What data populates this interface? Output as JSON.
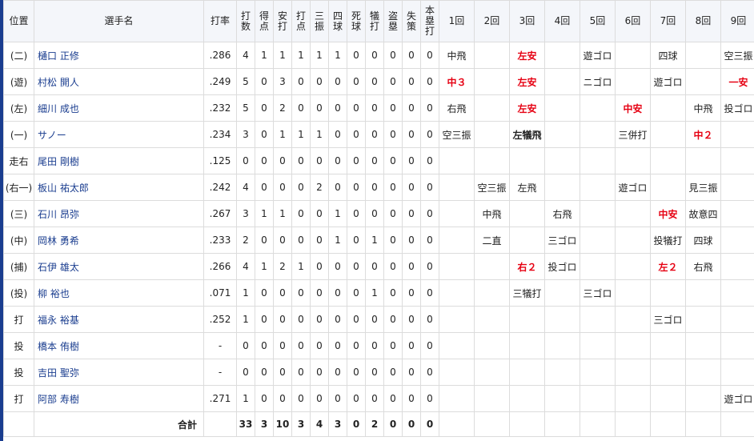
{
  "headers": {
    "pos": "位置",
    "name": "選手名",
    "stats": [
      "打率",
      "打数",
      "得点",
      "安打",
      "打点",
      "三振",
      "四球",
      "死球",
      "犠打",
      "盗塁",
      "失策",
      "本塁打"
    ],
    "innings": [
      "1回",
      "2回",
      "3回",
      "4回",
      "5回",
      "6回",
      "7回",
      "8回",
      "9回"
    ]
  },
  "players": [
    {
      "pos": "(二)",
      "name": "樋口 正修",
      "avg": ".286",
      "stats": [
        "4",
        "1",
        "1",
        "1",
        "1",
        "1",
        "0",
        "0",
        "0",
        "0",
        "0"
      ],
      "innings": [
        {
          "t": "中飛",
          "c": ""
        },
        {
          "t": "",
          "c": ""
        },
        {
          "t": "左安",
          "c": "red"
        },
        {
          "t": "",
          "c": ""
        },
        {
          "t": "遊ゴロ",
          "c": ""
        },
        {
          "t": "",
          "c": ""
        },
        {
          "t": "四球",
          "c": ""
        },
        {
          "t": "",
          "c": ""
        },
        {
          "t": "空三振",
          "c": ""
        }
      ]
    },
    {
      "pos": "(遊)",
      "name": "村松 開人",
      "avg": ".249",
      "stats": [
        "5",
        "0",
        "3",
        "0",
        "0",
        "0",
        "0",
        "0",
        "0",
        "0",
        "0"
      ],
      "innings": [
        {
          "t": "中３",
          "c": "red"
        },
        {
          "t": "",
          "c": ""
        },
        {
          "t": "左安",
          "c": "red"
        },
        {
          "t": "",
          "c": ""
        },
        {
          "t": "ニゴロ",
          "c": ""
        },
        {
          "t": "",
          "c": ""
        },
        {
          "t": "遊ゴロ",
          "c": ""
        },
        {
          "t": "",
          "c": ""
        },
        {
          "t": "一安",
          "c": "red"
        }
      ]
    },
    {
      "pos": "(左)",
      "name": "細川 成也",
      "avg": ".232",
      "stats": [
        "5",
        "0",
        "2",
        "0",
        "0",
        "0",
        "0",
        "0",
        "0",
        "0",
        "0"
      ],
      "innings": [
        {
          "t": "右飛",
          "c": ""
        },
        {
          "t": "",
          "c": ""
        },
        {
          "t": "左安",
          "c": "red"
        },
        {
          "t": "",
          "c": ""
        },
        {
          "t": "",
          "c": ""
        },
        {
          "t": "中安",
          "c": "red"
        },
        {
          "t": "",
          "c": ""
        },
        {
          "t": "中飛",
          "c": ""
        },
        {
          "t": "投ゴロ",
          "c": ""
        }
      ]
    },
    {
      "pos": "(一)",
      "name": "サノー",
      "avg": ".234",
      "stats": [
        "3",
        "0",
        "1",
        "1",
        "1",
        "0",
        "0",
        "0",
        "0",
        "0",
        "0"
      ],
      "innings": [
        {
          "t": "空三振",
          "c": ""
        },
        {
          "t": "",
          "c": ""
        },
        {
          "t": "左犠飛",
          "c": "bold"
        },
        {
          "t": "",
          "c": ""
        },
        {
          "t": "",
          "c": ""
        },
        {
          "t": "三併打",
          "c": ""
        },
        {
          "t": "",
          "c": ""
        },
        {
          "t": "中２",
          "c": "red"
        },
        {
          "t": "",
          "c": ""
        }
      ]
    },
    {
      "pos": "走右",
      "name": "尾田 剛樹",
      "avg": ".125",
      "stats": [
        "0",
        "0",
        "0",
        "0",
        "0",
        "0",
        "0",
        "0",
        "0",
        "0",
        "0"
      ],
      "innings": [
        {
          "t": "",
          "c": ""
        },
        {
          "t": "",
          "c": ""
        },
        {
          "t": "",
          "c": ""
        },
        {
          "t": "",
          "c": ""
        },
        {
          "t": "",
          "c": ""
        },
        {
          "t": "",
          "c": ""
        },
        {
          "t": "",
          "c": ""
        },
        {
          "t": "",
          "c": ""
        },
        {
          "t": "",
          "c": ""
        }
      ]
    },
    {
      "pos": "(右一)",
      "name": "板山 祐太郎",
      "avg": ".242",
      "stats": [
        "4",
        "0",
        "0",
        "0",
        "2",
        "0",
        "0",
        "0",
        "0",
        "0",
        "0"
      ],
      "innings": [
        {
          "t": "",
          "c": ""
        },
        {
          "t": "空三振",
          "c": ""
        },
        {
          "t": "左飛",
          "c": ""
        },
        {
          "t": "",
          "c": ""
        },
        {
          "t": "",
          "c": ""
        },
        {
          "t": "遊ゴロ",
          "c": ""
        },
        {
          "t": "",
          "c": ""
        },
        {
          "t": "見三振",
          "c": ""
        },
        {
          "t": "",
          "c": ""
        }
      ]
    },
    {
      "pos": "(三)",
      "name": "石川 昂弥",
      "avg": ".267",
      "stats": [
        "3",
        "1",
        "1",
        "0",
        "0",
        "1",
        "0",
        "0",
        "0",
        "0",
        "0"
      ],
      "innings": [
        {
          "t": "",
          "c": ""
        },
        {
          "t": "中飛",
          "c": ""
        },
        {
          "t": "",
          "c": ""
        },
        {
          "t": "右飛",
          "c": ""
        },
        {
          "t": "",
          "c": ""
        },
        {
          "t": "",
          "c": ""
        },
        {
          "t": "中安",
          "c": "red"
        },
        {
          "t": "故意四",
          "c": ""
        },
        {
          "t": "",
          "c": ""
        }
      ]
    },
    {
      "pos": "(中)",
      "name": "岡林 勇希",
      "avg": ".233",
      "stats": [
        "2",
        "0",
        "0",
        "0",
        "0",
        "1",
        "0",
        "1",
        "0",
        "0",
        "0"
      ],
      "innings": [
        {
          "t": "",
          "c": ""
        },
        {
          "t": "二直",
          "c": ""
        },
        {
          "t": "",
          "c": ""
        },
        {
          "t": "三ゴロ",
          "c": ""
        },
        {
          "t": "",
          "c": ""
        },
        {
          "t": "",
          "c": ""
        },
        {
          "t": "投犠打",
          "c": ""
        },
        {
          "t": "四球",
          "c": ""
        },
        {
          "t": "",
          "c": ""
        }
      ]
    },
    {
      "pos": "(捕)",
      "name": "石伊 雄太",
      "avg": ".266",
      "stats": [
        "4",
        "1",
        "2",
        "1",
        "0",
        "0",
        "0",
        "0",
        "0",
        "0",
        "0"
      ],
      "innings": [
        {
          "t": "",
          "c": ""
        },
        {
          "t": "",
          "c": ""
        },
        {
          "t": "右２",
          "c": "red"
        },
        {
          "t": "投ゴロ",
          "c": ""
        },
        {
          "t": "",
          "c": ""
        },
        {
          "t": "",
          "c": ""
        },
        {
          "t": "左２",
          "c": "red"
        },
        {
          "t": "右飛",
          "c": ""
        },
        {
          "t": "",
          "c": ""
        }
      ]
    },
    {
      "pos": "(投)",
      "name": "柳 裕也",
      "avg": ".071",
      "stats": [
        "1",
        "0",
        "0",
        "0",
        "0",
        "0",
        "0",
        "1",
        "0",
        "0",
        "0"
      ],
      "innings": [
        {
          "t": "",
          "c": ""
        },
        {
          "t": "",
          "c": ""
        },
        {
          "t": "三犠打",
          "c": ""
        },
        {
          "t": "",
          "c": ""
        },
        {
          "t": "三ゴロ",
          "c": ""
        },
        {
          "t": "",
          "c": ""
        },
        {
          "t": "",
          "c": ""
        },
        {
          "t": "",
          "c": ""
        },
        {
          "t": "",
          "c": ""
        }
      ]
    },
    {
      "pos": "打",
      "name": "福永 裕基",
      "avg": ".252",
      "stats": [
        "1",
        "0",
        "0",
        "0",
        "0",
        "0",
        "0",
        "0",
        "0",
        "0",
        "0"
      ],
      "innings": [
        {
          "t": "",
          "c": ""
        },
        {
          "t": "",
          "c": ""
        },
        {
          "t": "",
          "c": ""
        },
        {
          "t": "",
          "c": ""
        },
        {
          "t": "",
          "c": ""
        },
        {
          "t": "",
          "c": ""
        },
        {
          "t": "三ゴロ",
          "c": ""
        },
        {
          "t": "",
          "c": ""
        },
        {
          "t": "",
          "c": ""
        }
      ]
    },
    {
      "pos": "投",
      "name": "橋本 侑樹",
      "avg": "-",
      "stats": [
        "0",
        "0",
        "0",
        "0",
        "0",
        "0",
        "0",
        "0",
        "0",
        "0",
        "0"
      ],
      "innings": [
        {
          "t": "",
          "c": ""
        },
        {
          "t": "",
          "c": ""
        },
        {
          "t": "",
          "c": ""
        },
        {
          "t": "",
          "c": ""
        },
        {
          "t": "",
          "c": ""
        },
        {
          "t": "",
          "c": ""
        },
        {
          "t": "",
          "c": ""
        },
        {
          "t": "",
          "c": ""
        },
        {
          "t": "",
          "c": ""
        }
      ]
    },
    {
      "pos": "投",
      "name": "吉田 聖弥",
      "avg": "-",
      "stats": [
        "0",
        "0",
        "0",
        "0",
        "0",
        "0",
        "0",
        "0",
        "0",
        "0",
        "0"
      ],
      "innings": [
        {
          "t": "",
          "c": ""
        },
        {
          "t": "",
          "c": ""
        },
        {
          "t": "",
          "c": ""
        },
        {
          "t": "",
          "c": ""
        },
        {
          "t": "",
          "c": ""
        },
        {
          "t": "",
          "c": ""
        },
        {
          "t": "",
          "c": ""
        },
        {
          "t": "",
          "c": ""
        },
        {
          "t": "",
          "c": ""
        }
      ]
    },
    {
      "pos": "打",
      "name": "阿部 寿樹",
      "avg": ".271",
      "stats": [
        "1",
        "0",
        "0",
        "0",
        "0",
        "0",
        "0",
        "0",
        "0",
        "0",
        "0"
      ],
      "innings": [
        {
          "t": "",
          "c": ""
        },
        {
          "t": "",
          "c": ""
        },
        {
          "t": "",
          "c": ""
        },
        {
          "t": "",
          "c": ""
        },
        {
          "t": "",
          "c": ""
        },
        {
          "t": "",
          "c": ""
        },
        {
          "t": "",
          "c": ""
        },
        {
          "t": "",
          "c": ""
        },
        {
          "t": "遊ゴロ",
          "c": ""
        }
      ]
    }
  ],
  "total": {
    "label": "合計",
    "stats": [
      "33",
      "3",
      "10",
      "3",
      "4",
      "3",
      "0",
      "2",
      "0",
      "0",
      "0"
    ]
  }
}
